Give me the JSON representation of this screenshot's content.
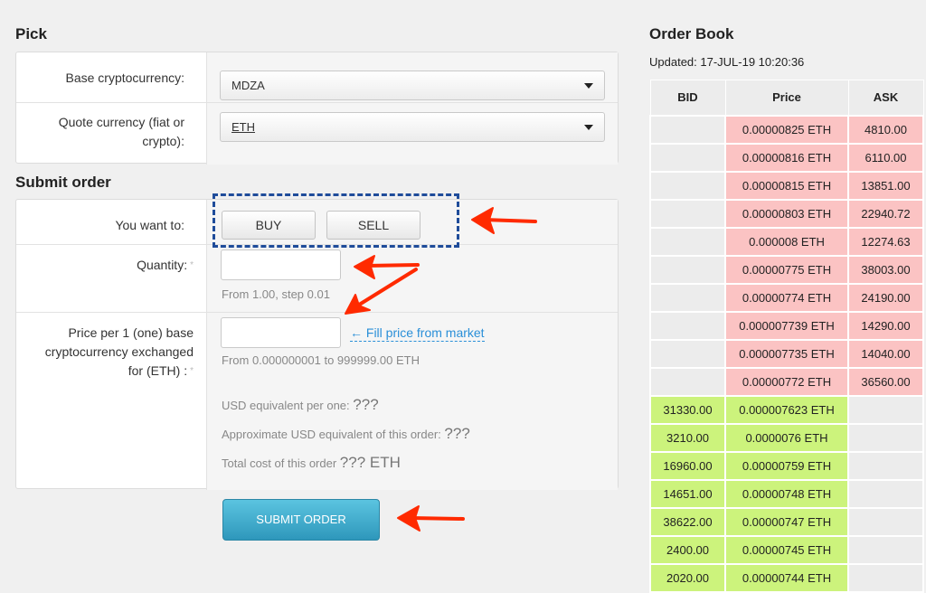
{
  "pick": {
    "title": "Pick",
    "base_label": "Base cryptocurrency:",
    "base_value": "MDZA",
    "quote_label": "Quote currency (fiat or crypto):",
    "quote_value": "ETH"
  },
  "order": {
    "title": "Submit order",
    "want_label": "You want to:",
    "buy_label": "BUY",
    "sell_label": "SELL",
    "quantity_label": "Quantity:",
    "quantity_value": "",
    "quantity_hint": "From 1.00, step 0.01",
    "price_label": "Price per 1 (one) base cryptocurrency exchanged for (ETH) :",
    "price_value": "",
    "fill_price_link": "← Fill price from market",
    "price_hint": "From 0.000000001 to 999999.00 ETH",
    "usd_per_one_label": "USD equivalent per one:",
    "usd_per_one_value": "???",
    "usd_order_label": "Approximate USD equivalent of this order:",
    "usd_order_value": "???",
    "total_cost_label": "Total cost of this order",
    "total_cost_value": "??? ETH",
    "required_mark": "*",
    "submit_label": "SUBMIT ORDER"
  },
  "order_book": {
    "title": "Order Book",
    "updated": "Updated: 17-JUL-19 10:20:36",
    "headers": [
      "BID",
      "Price",
      "ASK"
    ],
    "asks": [
      {
        "price": "0.00000825 ETH",
        "ask": "4810.00"
      },
      {
        "price": "0.00000816 ETH",
        "ask": "6110.00"
      },
      {
        "price": "0.00000815 ETH",
        "ask": "13851.00"
      },
      {
        "price": "0.00000803 ETH",
        "ask": "22940.72"
      },
      {
        "price": "0.000008 ETH",
        "ask": "12274.63"
      },
      {
        "price": "0.00000775 ETH",
        "ask": "38003.00"
      },
      {
        "price": "0.00000774 ETH",
        "ask": "24190.00"
      },
      {
        "price": "0.000007739 ETH",
        "ask": "14290.00"
      },
      {
        "price": "0.000007735 ETH",
        "ask": "14040.00"
      },
      {
        "price": "0.00000772 ETH",
        "ask": "36560.00"
      }
    ],
    "bids": [
      {
        "bid": "31330.00",
        "price": "0.000007623 ETH"
      },
      {
        "bid": "3210.00",
        "price": "0.0000076 ETH"
      },
      {
        "bid": "16960.00",
        "price": "0.00000759 ETH"
      },
      {
        "bid": "14651.00",
        "price": "0.00000748 ETH"
      },
      {
        "bid": "38622.00",
        "price": "0.00000747 ETH"
      },
      {
        "bid": "2400.00",
        "price": "0.00000745 ETH"
      },
      {
        "bid": "2020.00",
        "price": "0.00000744 ETH"
      }
    ]
  },
  "colors": {
    "ask_bg": "#fbc3c3",
    "bid_bg": "#ccf37c",
    "submit_bg": "#3aa7c9",
    "link": "#2a8fd8",
    "annotation_arrow": "#ff2a00",
    "annotation_box": "#1f4c9a"
  }
}
